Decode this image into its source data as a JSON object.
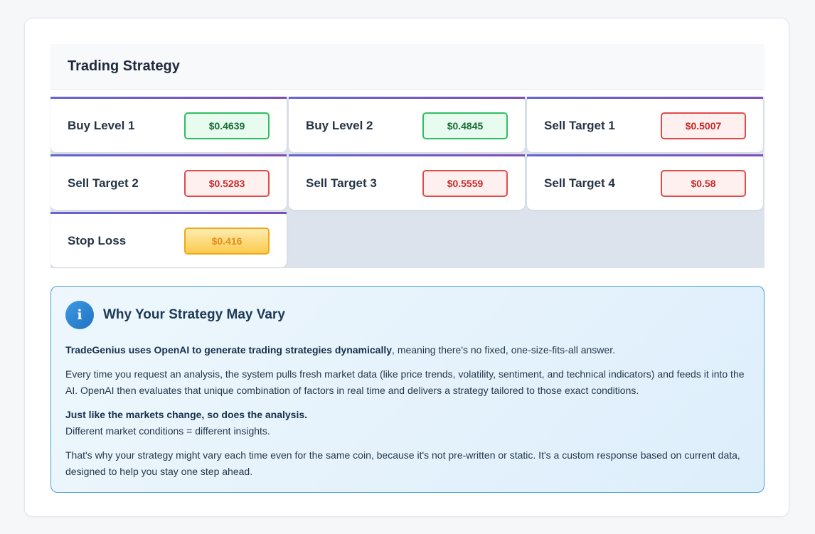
{
  "header": {
    "title": "Trading Strategy"
  },
  "levels": [
    {
      "label": "Buy Level 1",
      "value": "$0.4639",
      "kind": "buy"
    },
    {
      "label": "Buy Level 2",
      "value": "$0.4845",
      "kind": "buy"
    },
    {
      "label": "Sell Target 1",
      "value": "$0.5007",
      "kind": "sell"
    },
    {
      "label": "Sell Target 2",
      "value": "$0.5283",
      "kind": "sell"
    },
    {
      "label": "Sell Target 3",
      "value": "$0.5559",
      "kind": "sell"
    },
    {
      "label": "Sell Target 4",
      "value": "$0.58",
      "kind": "sell"
    },
    {
      "label": "Stop Loss",
      "value": "$0.416",
      "kind": "stop"
    }
  ],
  "info": {
    "icon": "info-icon",
    "icon_glyph": "i",
    "title": "Why Your Strategy May Vary",
    "p1_bold": "TradeGenius uses OpenAI to generate trading strategies dynamically",
    "p1_rest": ", meaning there's no fixed, one-size-fits-all answer.",
    "p2": "Every time you request an analysis, the system pulls fresh market data (like price trends, volatility, sentiment, and technical indicators) and feeds it into the AI. OpenAI then evaluates that unique combination of factors in real time and delivers a strategy tailored to those exact conditions.",
    "p3_bold": "Just like the markets change, so does the analysis.",
    "p3_rest": "Different market conditions = different insights.",
    "p4": "That's why your strategy might vary each time even for the same coin, because it's not pre-written or static. It's a custom response based on current data, designed to help you stay one step ahead."
  },
  "colors": {
    "accent": "#6366d1",
    "buy": "#2fbf62",
    "sell": "#e24a4a",
    "stop": "#f2a719",
    "info_border": "#4a9fd6"
  }
}
